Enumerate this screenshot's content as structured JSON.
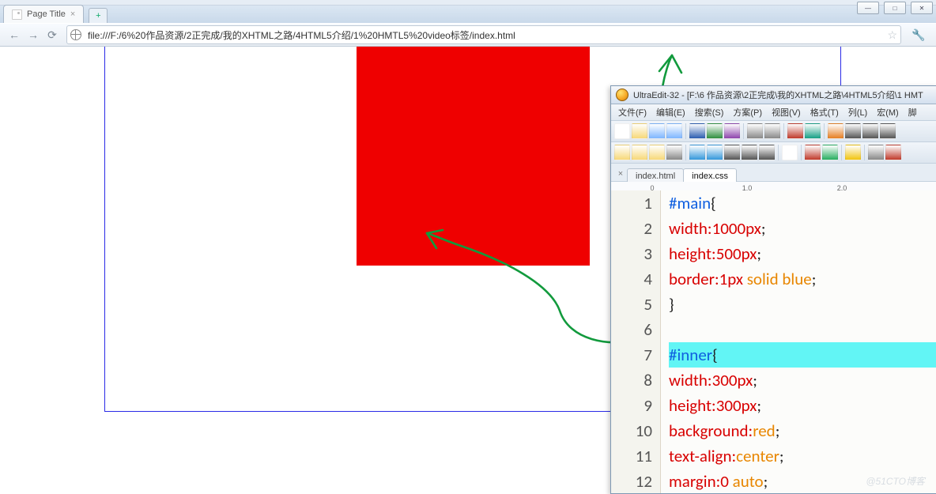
{
  "browser": {
    "page_title": "Page Title",
    "back": "←",
    "forward": "→",
    "reload": "⟳",
    "url": "file:///F:/6%20作品资源/2正完成/我的XHTML之路/4HTML5介绍/1%20HMTL5%20video标签/index.html",
    "star": "☆",
    "wrench": "🔧",
    "newtab": "+",
    "tab_close": "×",
    "win_min": "—",
    "win_max": "□",
    "win_close": "✕"
  },
  "ultraedit": {
    "title": "UltraEdit-32 - [F:\\6 作品资源\\2正完成\\我的XHTML之路\\4HTML5介绍\\1 HMT",
    "menus": [
      "文件(F)",
      "编辑(E)",
      "搜索(S)",
      "方案(P)",
      "视图(V)",
      "格式(T)",
      "列(L)",
      "宏(M)",
      "脚"
    ],
    "doc_tabs": [
      "index.html",
      "index.css"
    ],
    "active_tab_index": 1,
    "tab_close": "×",
    "ruler_labels": [
      "0",
      "1.0",
      "2.0"
    ],
    "code_lines": [
      {
        "n": "1",
        "hl": false,
        "segs": [
          {
            "t": "#main",
            "c": "tok-sel"
          },
          {
            "t": "{",
            "c": "tok-punc"
          }
        ]
      },
      {
        "n": "2",
        "hl": false,
        "segs": [
          {
            "t": "width:",
            "c": "tok-prop"
          },
          {
            "t": "1000px",
            "c": "tok-prop"
          },
          {
            "t": ";",
            "c": "tok-punc"
          }
        ]
      },
      {
        "n": "3",
        "hl": false,
        "segs": [
          {
            "t": "height:",
            "c": "tok-prop"
          },
          {
            "t": "500px",
            "c": "tok-prop"
          },
          {
            "t": ";",
            "c": "tok-punc"
          }
        ]
      },
      {
        "n": "4",
        "hl": false,
        "segs": [
          {
            "t": "border:",
            "c": "tok-prop"
          },
          {
            "t": "1px ",
            "c": "tok-prop"
          },
          {
            "t": "solid blue",
            "c": "tok-kw"
          },
          {
            "t": ";",
            "c": "tok-punc"
          }
        ]
      },
      {
        "n": "5",
        "hl": false,
        "segs": [
          {
            "t": "}",
            "c": "tok-punc"
          }
        ]
      },
      {
        "n": "6",
        "hl": false,
        "segs": []
      },
      {
        "n": "7",
        "hl": true,
        "segs": [
          {
            "t": "#inner",
            "c": "tok-sel"
          },
          {
            "t": "{",
            "c": "tok-punc"
          }
        ]
      },
      {
        "n": "8",
        "hl": false,
        "segs": [
          {
            "t": "width:",
            "c": "tok-prop"
          },
          {
            "t": "300px",
            "c": "tok-prop"
          },
          {
            "t": ";",
            "c": "tok-punc"
          }
        ]
      },
      {
        "n": "9",
        "hl": false,
        "segs": [
          {
            "t": "height:",
            "c": "tok-prop"
          },
          {
            "t": "300px",
            "c": "tok-prop"
          },
          {
            "t": ";",
            "c": "tok-punc"
          }
        ]
      },
      {
        "n": "10",
        "hl": false,
        "segs": [
          {
            "t": "background:",
            "c": "tok-prop"
          },
          {
            "t": "red",
            "c": "tok-kw"
          },
          {
            "t": ";",
            "c": "tok-punc"
          }
        ]
      },
      {
        "n": "11",
        "hl": false,
        "segs": [
          {
            "t": "text-align:",
            "c": "tok-prop"
          },
          {
            "t": "center",
            "c": "tok-kw"
          },
          {
            "t": ";",
            "c": "tok-punc"
          }
        ]
      },
      {
        "n": "12",
        "hl": false,
        "segs": [
          {
            "t": "margin:",
            "c": "tok-prop"
          },
          {
            "t": "0 ",
            "c": "tok-prop"
          },
          {
            "t": "auto",
            "c": "tok-kw"
          },
          {
            "t": ";",
            "c": "tok-punc"
          }
        ]
      }
    ],
    "toolbar_row1_icons": [
      "new",
      "open",
      "save",
      "saveall",
      "|",
      "word",
      "excel",
      "data",
      "|",
      "list",
      "rtl",
      "|",
      "db",
      "net",
      "|",
      "find",
      "cut",
      "copy",
      "paste"
    ],
    "toolbar_row2_icons": [
      "folder1",
      "folder2",
      "folder3",
      "print",
      "|",
      "col1",
      "col2",
      "cut",
      "copy",
      "paste",
      "|",
      "page",
      "|",
      "undo",
      "redo",
      "|",
      "mark",
      "|",
      "sort",
      "del"
    ]
  },
  "watermark": "@51CTO博客"
}
